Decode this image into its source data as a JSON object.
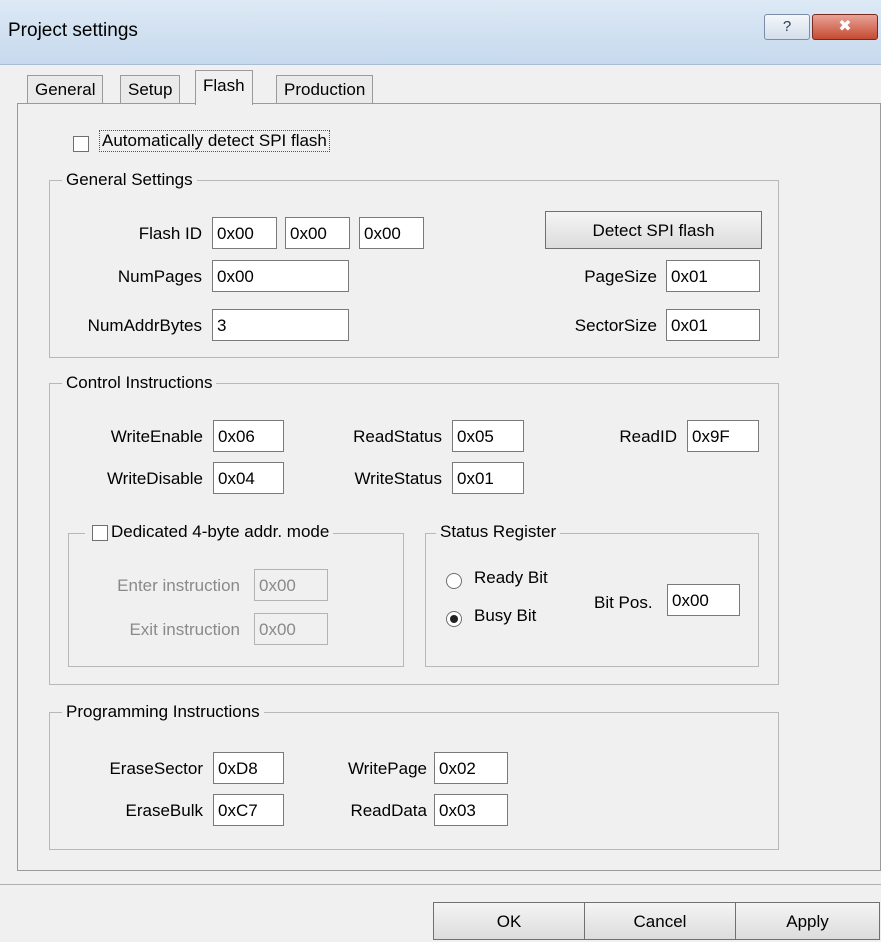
{
  "window": {
    "title": "Project settings",
    "help_glyph": "?",
    "close_glyph": "✖"
  },
  "tabs": [
    {
      "label": "General"
    },
    {
      "label": "Setup"
    },
    {
      "label": "Flash"
    },
    {
      "label": "Production"
    }
  ],
  "auto_detect": {
    "label": "Automatically detect SPI flash",
    "checked": false
  },
  "general_settings": {
    "legend": "General Settings",
    "flash_id_label": "Flash ID",
    "flash_id": [
      "0x00",
      "0x00",
      "0x00"
    ],
    "detect_button": "Detect SPI flash",
    "num_pages_label": "NumPages",
    "num_pages": "0x00",
    "page_size_label": "PageSize",
    "page_size": "0x01",
    "num_addr_bytes_label": "NumAddrBytes",
    "num_addr_bytes": "3",
    "sector_size_label": "SectorSize",
    "sector_size": "0x01"
  },
  "control_instructions": {
    "legend": "Control Instructions",
    "write_enable_label": "WriteEnable",
    "write_enable": "0x06",
    "read_status_label": "ReadStatus",
    "read_status": "0x05",
    "read_id_label": "ReadID",
    "read_id": "0x9F",
    "write_disable_label": "WriteDisable",
    "write_disable": "0x04",
    "write_status_label": "WriteStatus",
    "write_status": "0x01",
    "four_byte": {
      "legend": "Dedicated 4-byte addr. mode",
      "checked": false,
      "enter_label": "Enter instruction",
      "enter_value": "0x00",
      "exit_label": "Exit instruction",
      "exit_value": "0x00"
    },
    "status_register": {
      "legend": "Status Register",
      "ready_label": "Ready Bit",
      "busy_label": "Busy Bit",
      "selected": "Busy Bit",
      "bit_pos_label": "Bit Pos.",
      "bit_pos": "0x00"
    }
  },
  "programming_instructions": {
    "legend": "Programming Instructions",
    "erase_sector_label": "EraseSector",
    "erase_sector": "0xD8",
    "write_page_label": "WritePage",
    "write_page": "0x02",
    "erase_bulk_label": "EraseBulk",
    "erase_bulk": "0xC7",
    "read_data_label": "ReadData",
    "read_data": "0x03"
  },
  "footer": {
    "ok": "OK",
    "cancel": "Cancel",
    "apply": "Apply"
  }
}
